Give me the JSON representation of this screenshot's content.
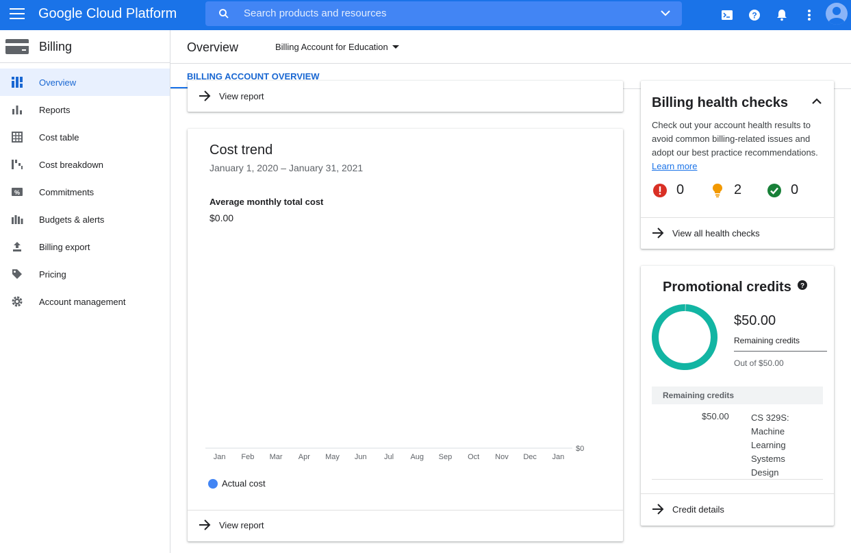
{
  "topbar": {
    "brand": "Google Cloud Platform",
    "search_placeholder": "Search products and resources",
    "icons": [
      "menu-icon",
      "search-icon",
      "chevron-down-icon",
      "cloud-shell-icon",
      "help-icon",
      "notifications-icon",
      "more-vert-icon",
      "account-avatar"
    ],
    "color": "#1a73e8"
  },
  "sidebar": {
    "title": "Billing",
    "items": [
      {
        "label": "Overview",
        "icon": "dashboard-icon",
        "active": true
      },
      {
        "label": "Reports",
        "icon": "bar-chart-icon"
      },
      {
        "label": "Cost table",
        "icon": "table-icon"
      },
      {
        "label": "Cost breakdown",
        "icon": "waterfall-icon"
      },
      {
        "label": "Commitments",
        "icon": "percent-icon"
      },
      {
        "label": "Budgets & alerts",
        "icon": "budget-icon"
      },
      {
        "label": "Billing export",
        "icon": "upload-icon"
      },
      {
        "label": "Pricing",
        "icon": "tag-icon"
      },
      {
        "label": "Account management",
        "icon": "gear-icon"
      }
    ]
  },
  "header": {
    "title": "Overview",
    "account": "Billing Account for Education"
  },
  "tabs": [
    {
      "label": "BILLING ACCOUNT OVERVIEW",
      "active": true
    }
  ],
  "top_card": {
    "link": "View report"
  },
  "cost_trend": {
    "title": "Cost trend",
    "range": "January 1, 2020 – January 31, 2021",
    "avg_label": "Average monthly total cost",
    "avg_value": "$0.00",
    "legend": "Actual cost",
    "link": "View report"
  },
  "chart_data": {
    "type": "bar",
    "categories": [
      "Jan",
      "Feb",
      "Mar",
      "Apr",
      "May",
      "Jun",
      "Jul",
      "Aug",
      "Sep",
      "Oct",
      "Nov",
      "Dec",
      "Jan"
    ],
    "series": [
      {
        "name": "Actual cost",
        "values": [
          0,
          0,
          0,
          0,
          0,
          0,
          0,
          0,
          0,
          0,
          0,
          0,
          0
        ],
        "color": "#4285f4"
      }
    ],
    "title": "Cost trend",
    "ytick": "$0",
    "legend": "bottom-left"
  },
  "health": {
    "title": "Billing health checks",
    "desc": "Check out your account health results to avoid common billing-related issues and adopt our best practice recommendations.",
    "learn_more": "Learn more",
    "errors": "0",
    "warnings": "2",
    "passed": "0",
    "link": "View all health checks",
    "colors": {
      "error": "#d93025",
      "warning": "#f29900",
      "ok": "#188038"
    }
  },
  "promo": {
    "title": "Promotional credits",
    "amount": "$50.00",
    "remaining_label": "Remaining credits",
    "out_of": "Out of $50.00",
    "remaining_fraction": 1.0,
    "table_header": "Remaining credits",
    "rows": [
      {
        "value": "$50.00",
        "name": "CS 329S: Machine Learning Systems Design"
      }
    ],
    "link": "Credit details",
    "color": "#12b5a3"
  }
}
